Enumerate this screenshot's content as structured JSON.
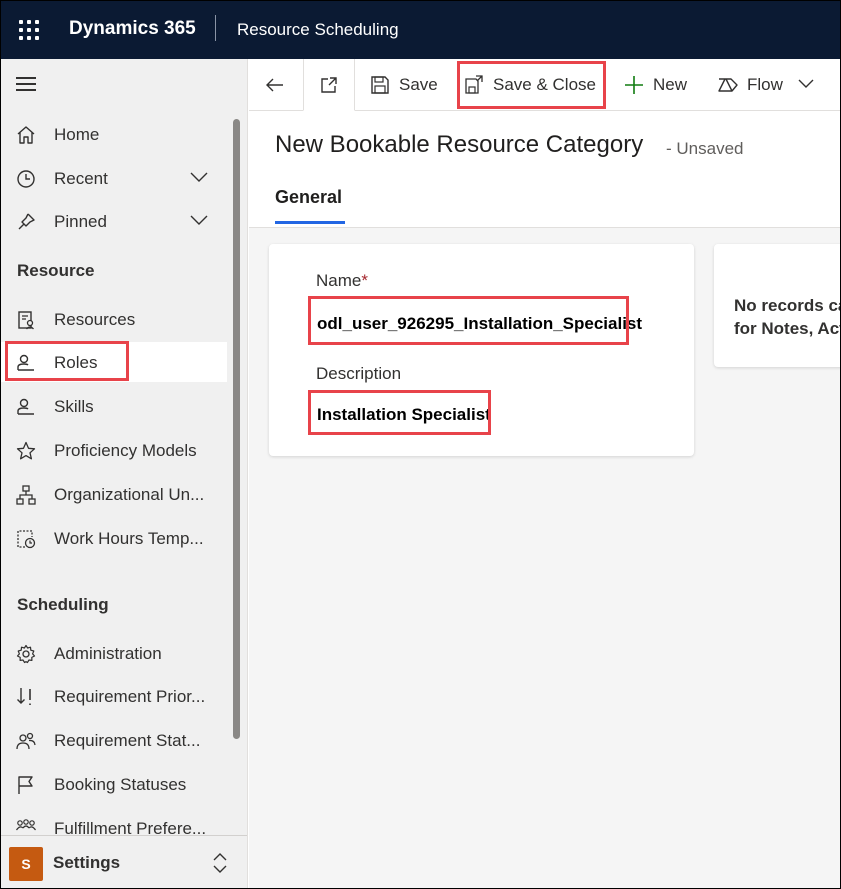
{
  "topbar": {
    "app_name": "Dynamics 365",
    "module_name": "Resource Scheduling"
  },
  "sidebar": {
    "top_items": [
      {
        "label": "Home",
        "icon": "home-icon"
      },
      {
        "label": "Recent",
        "icon": "clock-icon"
      },
      {
        "label": "Pinned",
        "icon": "pin-icon"
      }
    ],
    "resource_section": {
      "title": "Resource",
      "items": [
        {
          "label": "Resources",
          "icon": "resources-icon"
        },
        {
          "label": "Roles",
          "icon": "person-icon",
          "active": true
        },
        {
          "label": "Skills",
          "icon": "person-icon"
        },
        {
          "label": "Proficiency Models",
          "icon": "star-icon"
        },
        {
          "label": "Organizational Un...",
          "icon": "org-chart-icon"
        },
        {
          "label": "Work Hours Temp...",
          "icon": "calendar-clock-icon"
        }
      ]
    },
    "scheduling_section": {
      "title": "Scheduling",
      "items": [
        {
          "label": "Administration",
          "icon": "gear-icon"
        },
        {
          "label": "Requirement Prior...",
          "icon": "sort-icon"
        },
        {
          "label": "Requirement Stat...",
          "icon": "people-icon"
        },
        {
          "label": "Booking Statuses",
          "icon": "flag-icon"
        },
        {
          "label": "Fulfillment Prefere...",
          "icon": "group-icon"
        }
      ]
    },
    "area": {
      "avatar_letter": "S",
      "label": "Settings",
      "avatar_color": "#c55a11"
    }
  },
  "commandbar": {
    "save_label": "Save",
    "save_close_label": "Save & Close",
    "new_label": "New",
    "flow_label": "Flow"
  },
  "form": {
    "title": "New Bookable Resource Category",
    "status": "- Unsaved",
    "tab_general": "General",
    "name_label": "Name",
    "required_mark": "*",
    "name_value": "odl_user_926295_Installation_Specialist",
    "description_label": "Description",
    "description_value": "Installation Specialist",
    "side_message_line1": "No records ca",
    "side_message_line2": "for Notes, Act"
  },
  "colors": {
    "topbar_bg": "#0b1a33",
    "highlight": "#e8434a",
    "accent": "#2266e3"
  }
}
